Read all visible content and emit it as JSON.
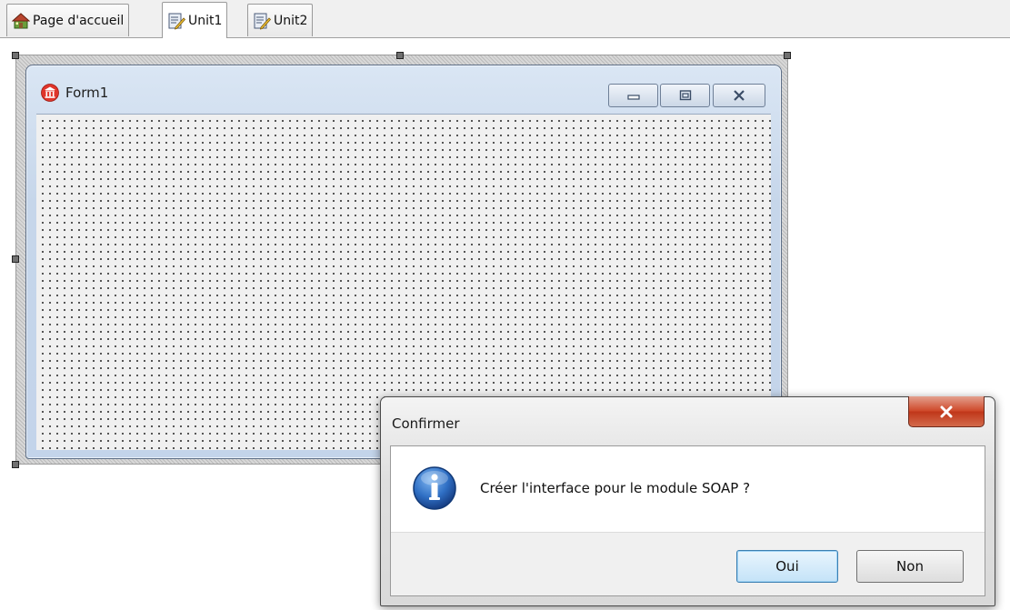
{
  "tabs": [
    {
      "label": "Page d'accueil",
      "icon": "home-icon",
      "active": false
    },
    {
      "label": "Unit1",
      "icon": "unit-file-icon",
      "active": true
    },
    {
      "label": "Unit2",
      "icon": "unit-file-icon",
      "active": false
    }
  ],
  "form": {
    "title": "Form1",
    "icon": "app-icon",
    "buttons": [
      "minimize-icon",
      "maximize-icon",
      "close-icon"
    ]
  },
  "dialog": {
    "title": "Confirmer",
    "message": "Créer l'interface pour le module SOAP ?",
    "icon": "info-icon",
    "yes_label": "Oui",
    "no_label": "Non"
  },
  "colors": {
    "window_frame": "#c6d6ea",
    "close_button": "#c0371a",
    "default_button_border": "#3c7fb1",
    "info_icon": "#1d5fb8"
  }
}
